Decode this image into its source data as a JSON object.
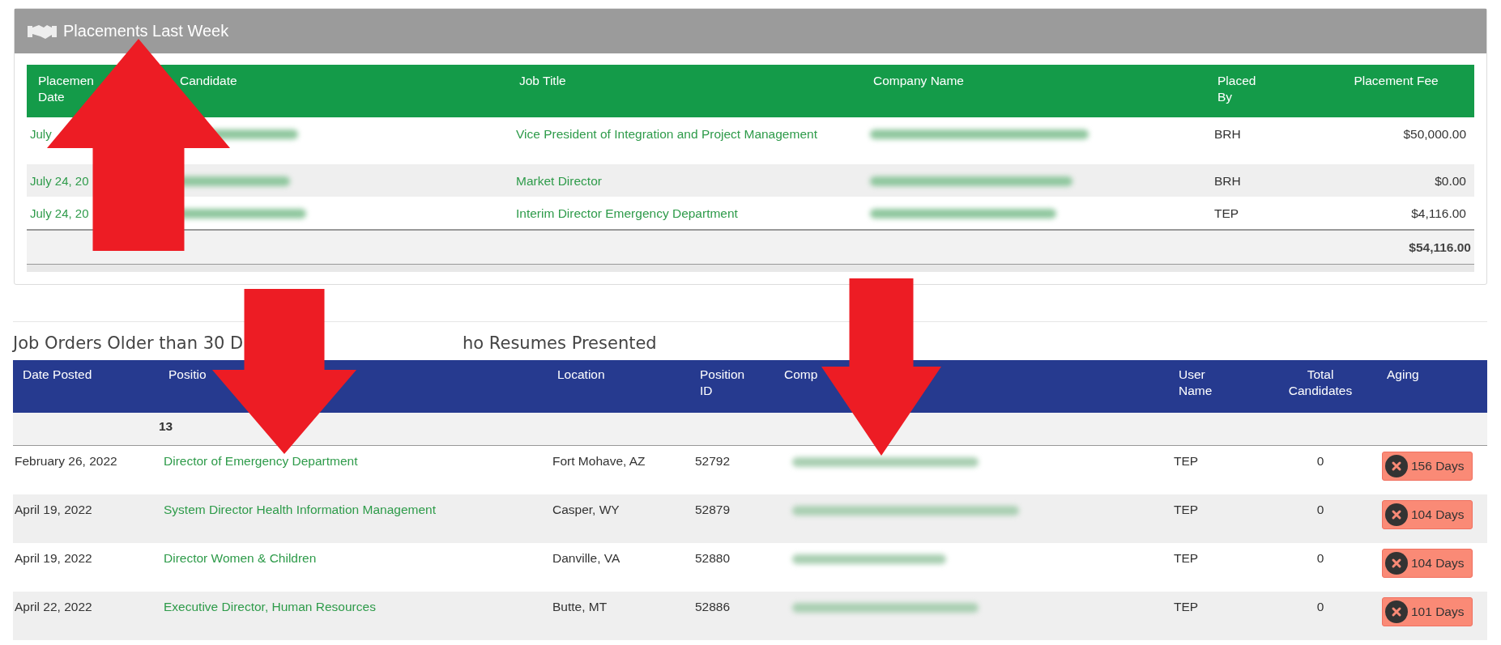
{
  "placements": {
    "title": "Placements Last Week",
    "columns": [
      "Placemen",
      "Candidate",
      "Job Title",
      "Company Name",
      "Placed\nBy",
      "Placement Fee"
    ],
    "rows": [
      {
        "date": "July",
        "candidate_blurred": true,
        "job_title": "Vice President of Integration and Project Management",
        "company_blurred": true,
        "placed_by": "BRH",
        "fee": "$50,000.00"
      },
      {
        "date": "July 24, 20",
        "candidate_blurred": true,
        "job_title": "Market Director",
        "company_blurred": true,
        "placed_by": "BRH",
        "fee": "$0.00"
      },
      {
        "date": "July 24, 20",
        "candidate_blurred": true,
        "job_title": "Interim Director Emergency Department",
        "company_blurred": true,
        "placed_by": "TEP",
        "fee": "$4,116.00"
      }
    ],
    "column_1_second_line": "Date",
    "total": "$54,116.00"
  },
  "job_orders": {
    "title_parts": [
      "Job Orders Older than 30 D",
      "ho Resumes Presented"
    ],
    "columns": [
      "Date Posted",
      "Positio",
      "Location",
      "Position\nID",
      "Comp",
      "User\nName",
      "Total\nCandidates",
      "Aging"
    ],
    "count": "13",
    "rows": [
      {
        "date_posted": "February 26, 2022",
        "position": "Director of Emergency Department",
        "location": "Fort Mohave, AZ",
        "position_id": "52792",
        "company_blurred": true,
        "user_name": "TEP",
        "total_candidates": "0",
        "aging": "156 Days"
      },
      {
        "date_posted": "April 19, 2022",
        "position": "System Director Health Information Management",
        "location": "Casper, WY",
        "position_id": "52879",
        "company_blurred": true,
        "user_name": "TEP",
        "total_candidates": "0",
        "aging": "104 Days"
      },
      {
        "date_posted": "April 19, 2022",
        "position": "Director Women & Children",
        "location": "Danville, VA",
        "position_id": "52880",
        "company_blurred": true,
        "user_name": "TEP",
        "total_candidates": "0",
        "aging": "104 Days"
      },
      {
        "date_posted": "April 22, 2022",
        "position": "Executive Director, Human Resources",
        "location": "Butte, MT",
        "position_id": "52886",
        "company_blurred": true,
        "user_name": "TEP",
        "total_candidates": "0",
        "aging": "101 Days"
      }
    ]
  },
  "annotation_arrows": [
    {
      "kind": "up"
    },
    {
      "kind": "down"
    },
    {
      "kind": "down"
    }
  ]
}
